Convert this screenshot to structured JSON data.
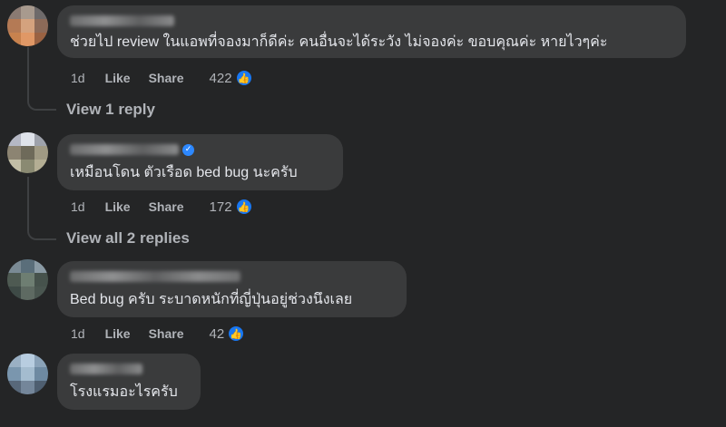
{
  "comments": [
    {
      "text": "ช่วยไป review ในแอพที่จองมาก็ดีค่ะ คนอื่นจะได้ระวัง ไม่จองค่ะ ขอบคุณค่ะ หายไวๆค่ะ",
      "time": "1d",
      "like_label": "Like",
      "share_label": "Share",
      "reaction_count": "422",
      "replies_link": "View 1 reply"
    },
    {
      "text": "เหมือนโดน ตัวเรือด bed bug นะครับ",
      "time": "1d",
      "like_label": "Like",
      "share_label": "Share",
      "reaction_count": "172",
      "replies_link": "View all 2 replies"
    },
    {
      "text": "Bed bug ครับ ระบาดหนักที่ญี่ปุ่นอยู่ช่วงนึงเลย",
      "time": "1d",
      "like_label": "Like",
      "share_label": "Share",
      "reaction_count": "42"
    },
    {
      "text": "โรงแรมอะไรครับ"
    }
  ],
  "colors": {
    "background": "#242526",
    "bubble": "#3a3b3c",
    "like_badge": "#1877f2",
    "verified_badge": "#2d88ff"
  },
  "icons": {
    "like": "like-thumb-icon",
    "verified": "verified-badge-icon"
  }
}
